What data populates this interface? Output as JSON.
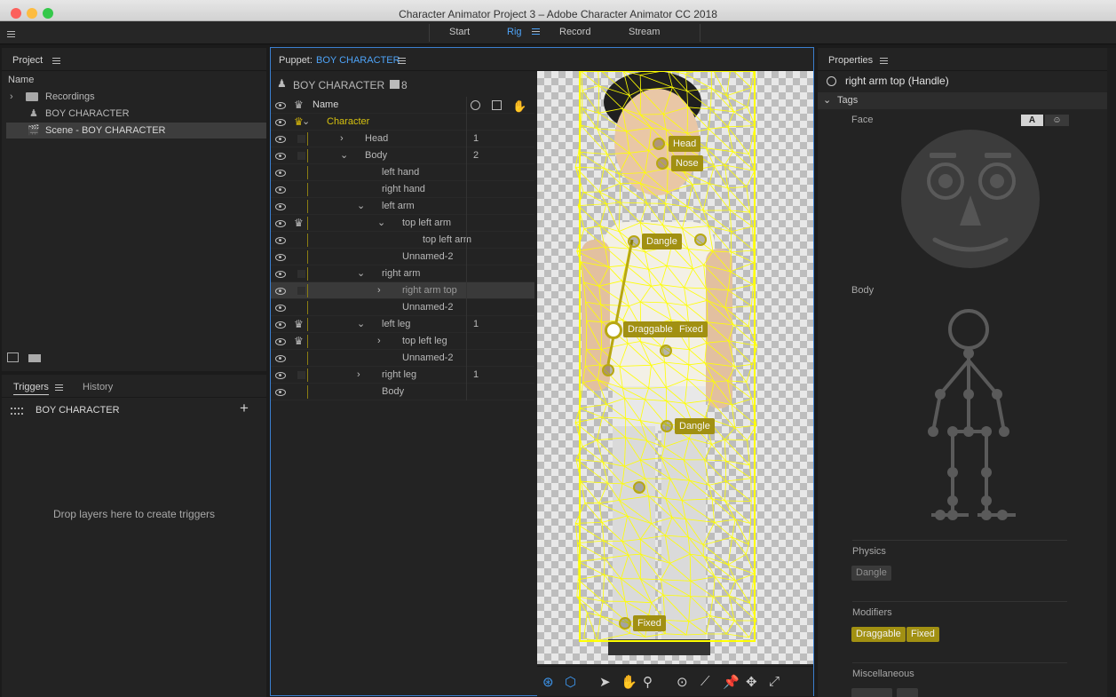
{
  "window": {
    "title": "Character Animator Project 3 – Adobe Character Animator CC 2018"
  },
  "workspace": {
    "tabs": [
      "Start",
      "Rig",
      "Record",
      "Stream"
    ],
    "active": "Rig"
  },
  "project": {
    "title": "Project",
    "column_header": "Name",
    "items": [
      "Recordings",
      "BOY CHARACTER",
      "Scene - BOY CHARACTER"
    ]
  },
  "triggers": {
    "tab": "Triggers",
    "history_tab": "History",
    "puppet": "BOY CHARACTER",
    "empty_text": "Drop layers here to create triggers"
  },
  "puppet": {
    "title_prefix": "Puppet:",
    "title_name": "BOY CHARACTER",
    "name": "BOY CHARACTER",
    "count": "8",
    "column_name": "Name",
    "layers": [
      {
        "name": "Character",
        "count": ""
      },
      {
        "name": "Head",
        "count": "1"
      },
      {
        "name": "Body",
        "count": "2"
      },
      {
        "name": "left hand",
        "count": ""
      },
      {
        "name": "right hand",
        "count": ""
      },
      {
        "name": "left arm",
        "count": ""
      },
      {
        "name": "top left arm",
        "count": ""
      },
      {
        "name": "top left arm",
        "count": ""
      },
      {
        "name": "Unnamed-2",
        "count": ""
      },
      {
        "name": "right arm",
        "count": ""
      },
      {
        "name": "right arm top",
        "count": ""
      },
      {
        "name": "Unnamed-2",
        "count": ""
      },
      {
        "name": "left leg",
        "count": "1"
      },
      {
        "name": "top left leg",
        "count": ""
      },
      {
        "name": "Unnamed-2",
        "count": ""
      },
      {
        "name": "right leg",
        "count": "1"
      },
      {
        "name": "Body",
        "count": ""
      }
    ]
  },
  "canvas": {
    "tags": [
      "Head",
      "Nose",
      "Dangle",
      "Draggable",
      "Fixed",
      "Dangle",
      "Fixed"
    ]
  },
  "properties": {
    "title": "Properties",
    "selected": "right arm top (Handle)",
    "tags_section": "Tags",
    "face_label": "Face",
    "face_toggle": "A",
    "body_label": "Body",
    "physics_label": "Physics",
    "physics_tags": [
      "Dangle"
    ],
    "modifiers_label": "Modifiers",
    "modifier_tags": [
      "Draggable",
      "Fixed"
    ],
    "misc_label": "Miscellaneous"
  },
  "colors": {
    "accent_blue": "#4ea3f7",
    "tag_gold": "#a19012",
    "mesh_yellow": "#ffff00"
  }
}
